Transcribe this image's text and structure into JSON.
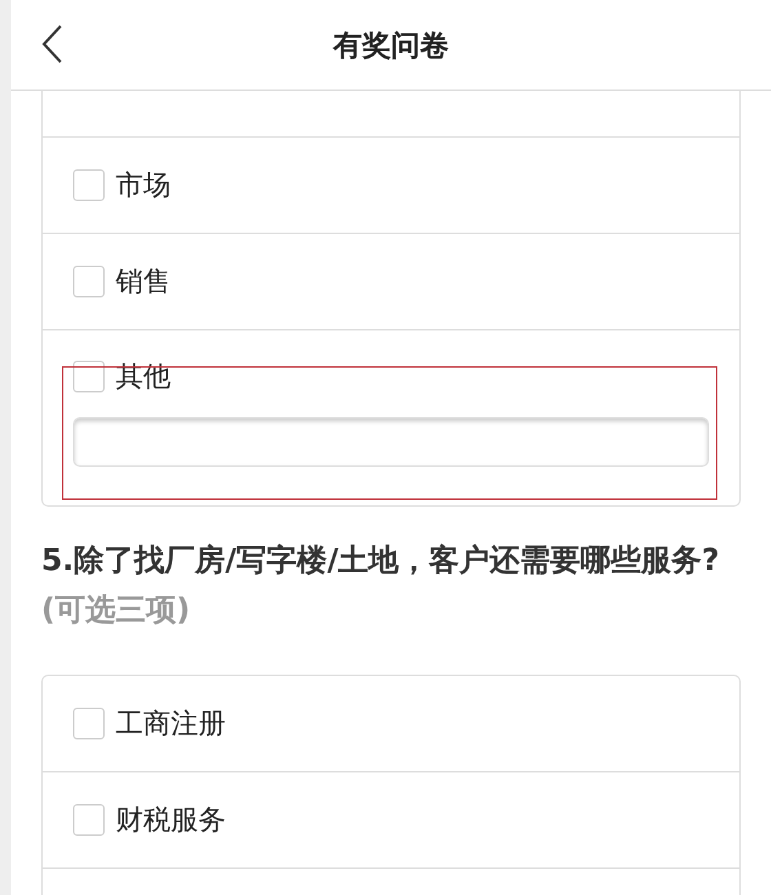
{
  "header": {
    "title": "有奖问卷"
  },
  "sections": [
    {
      "options": [
        {
          "label": "市场",
          "checked": false
        },
        {
          "label": "销售",
          "checked": false
        },
        {
          "label": "其他",
          "checked": false,
          "kind": "with-input",
          "highlighted": true
        }
      ]
    },
    {
      "title": "5.除了找厂房/写字楼/土地，客户还需要哪些服务?",
      "hint": "(可选三项)",
      "options": [
        {
          "label": "工商注册",
          "checked": false
        },
        {
          "label": "财税服务",
          "checked": false
        }
      ]
    }
  ]
}
